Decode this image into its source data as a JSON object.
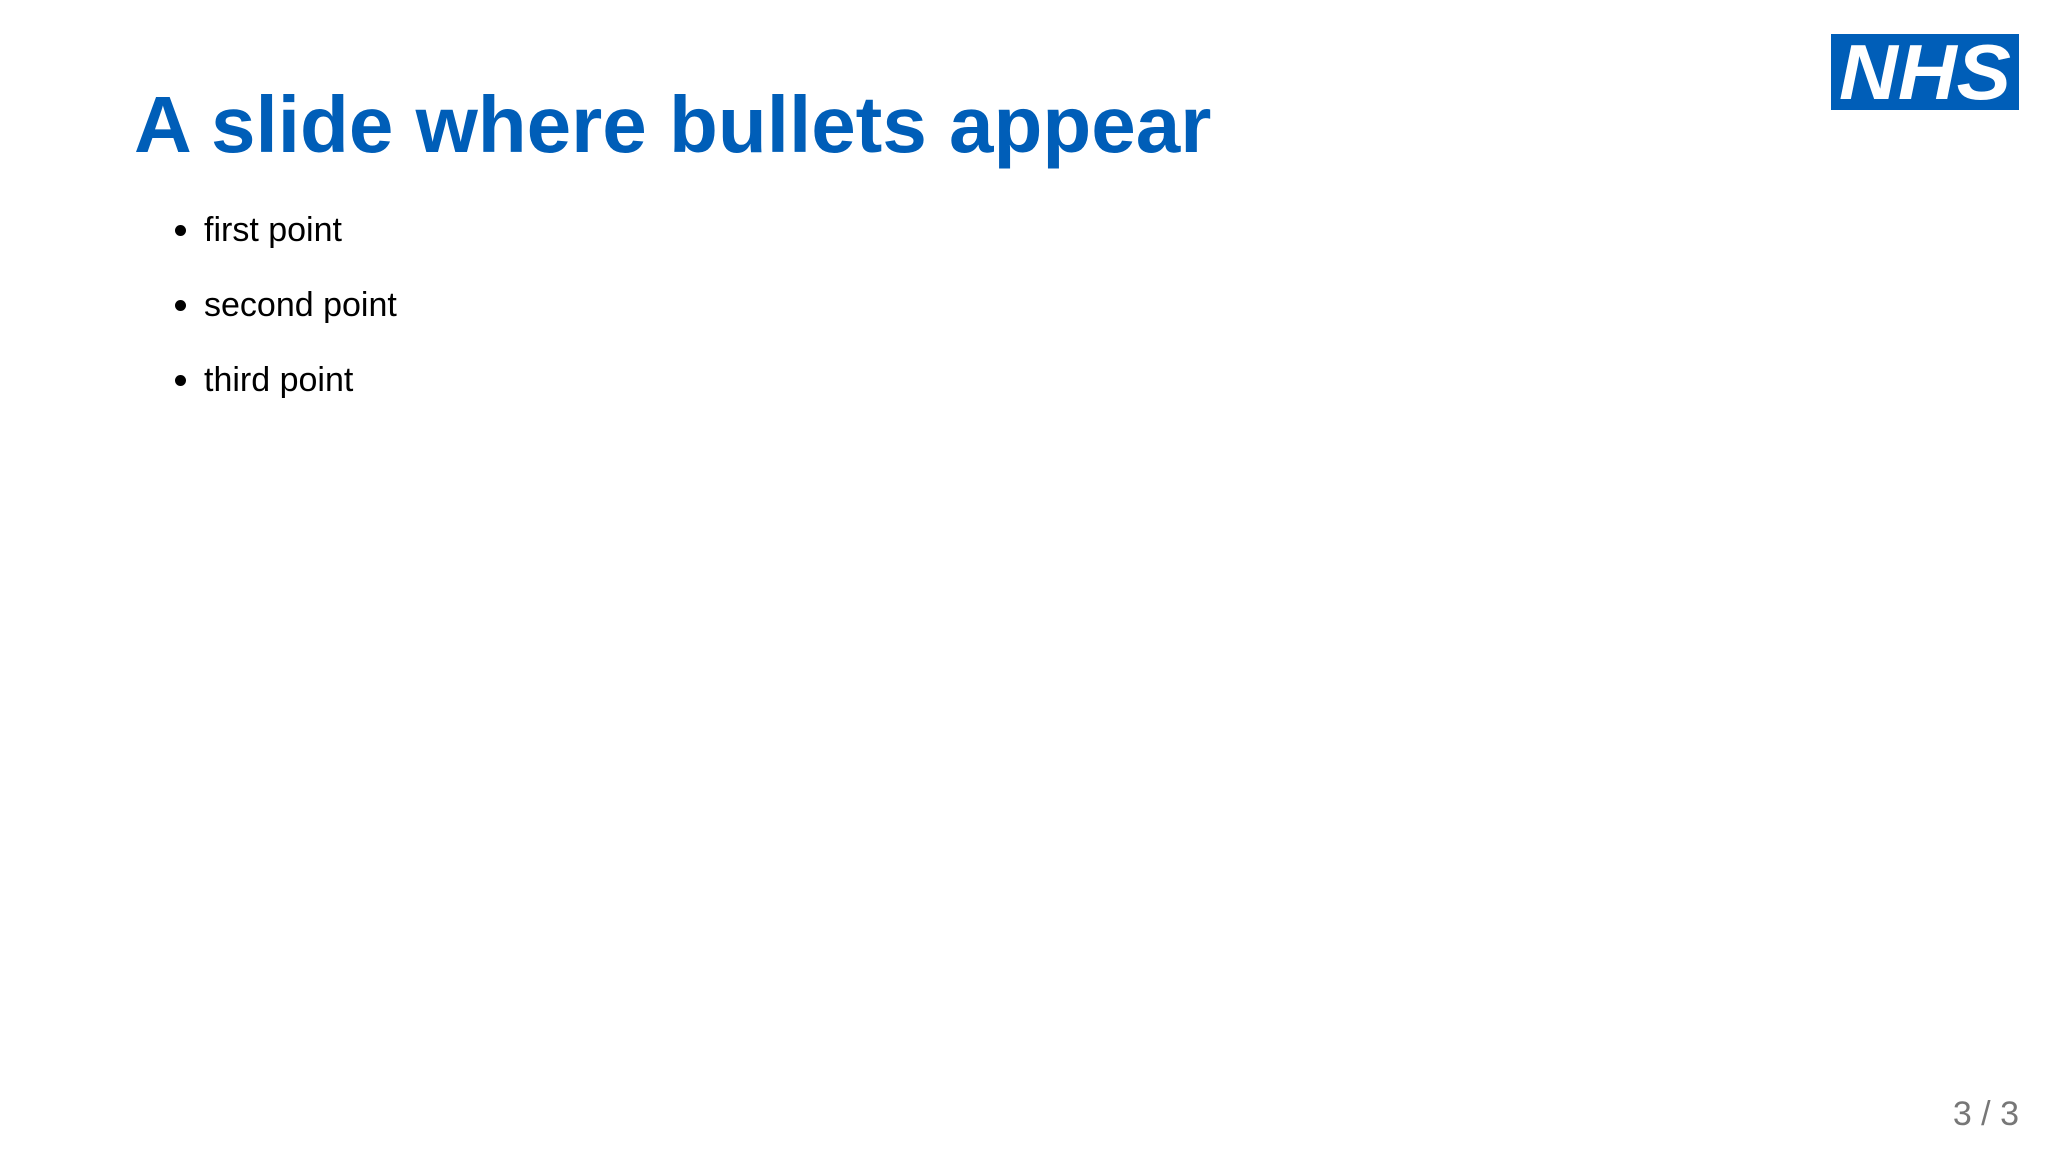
{
  "slide": {
    "title": "A slide where bullets appear",
    "bullets": [
      {
        "label": "first point"
      },
      {
        "label": "second point"
      },
      {
        "label": "third point"
      }
    ],
    "logo": {
      "text": "NHS",
      "background_color": "#005eb8",
      "text_color": "#ffffff"
    },
    "page_counter": "3 / 3"
  },
  "colors": {
    "title": "#005eb8",
    "body_text": "#000000",
    "page_counter": "#777777",
    "background": "#ffffff"
  }
}
